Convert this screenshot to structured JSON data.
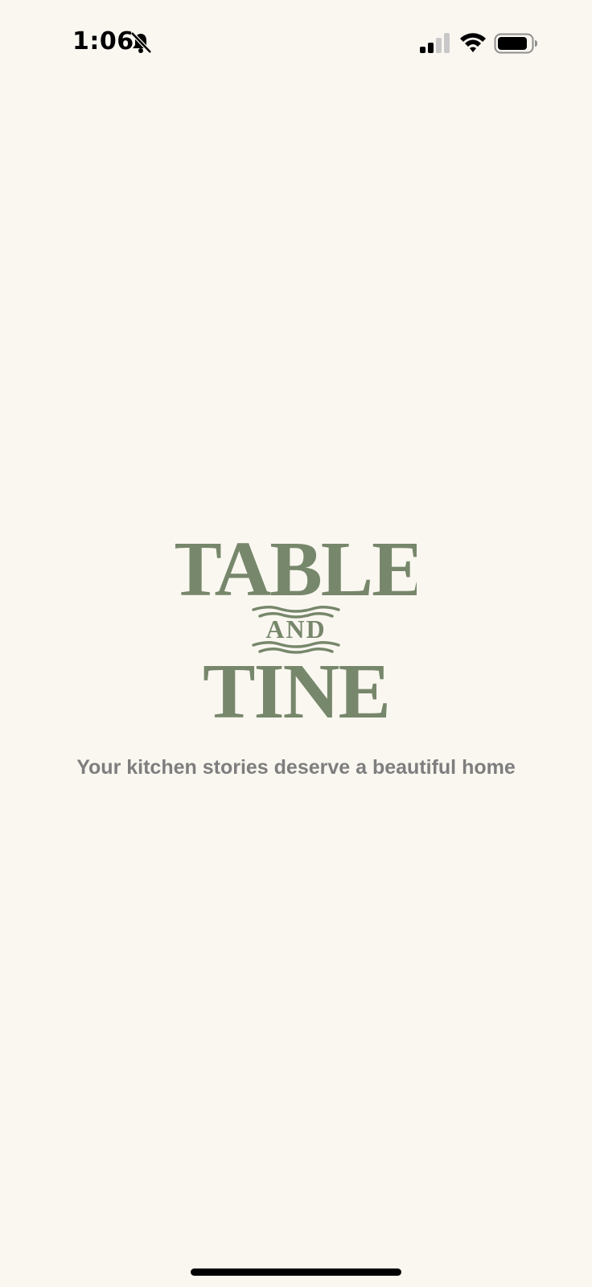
{
  "status_bar": {
    "time": "1:06",
    "icons": [
      "bell-slash-icon",
      "cellular-signal-icon",
      "wifi-icon",
      "battery-icon"
    ]
  },
  "splash": {
    "logo": {
      "line1": "TABLE",
      "line2": "AND",
      "line3": "TINE",
      "color": "#77876B"
    },
    "tagline": "Your kitchen stories deserve a beautiful home",
    "tagline_color": "#7E7E7E"
  },
  "colors": {
    "background": "#FAF7F1"
  }
}
